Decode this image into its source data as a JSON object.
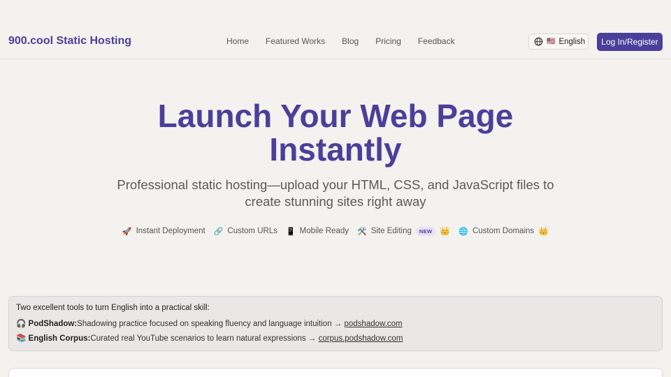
{
  "header": {
    "brand": "900.cool Static Hosting",
    "nav": [
      "Home",
      "Featured Works",
      "Blog",
      "Pricing",
      "Feedback"
    ],
    "language": {
      "flag": "🇺🇸",
      "label": "English",
      "icon": "globe-icon"
    },
    "login_label": "Log In/Register"
  },
  "hero": {
    "title_line1": "Launch Your Web Page",
    "title_line2": "Instantly",
    "subtitle_line1": "Professional static hosting—upload your HTML, CSS, and JavaScript files to",
    "subtitle_line2": "create stunning sites right away"
  },
  "features": [
    {
      "emoji": "🚀",
      "label": "Instant Deployment"
    },
    {
      "emoji": "🔗",
      "label": "Custom URLs"
    },
    {
      "emoji": "📱",
      "label": "Mobile Ready"
    },
    {
      "emoji": "🛠️",
      "label": "Site Editing",
      "badge": "NEW",
      "premium": "👑"
    },
    {
      "emoji": "🌐",
      "label": "Custom Domains",
      "premium": "👑"
    }
  ],
  "promo": {
    "title": "Two excellent tools to turn English into a practical skill:",
    "items": [
      {
        "emoji": "🎧",
        "name": "PodShadow:",
        "desc": "Shadowing practice focused on speaking fluency and language intuition → ",
        "link": "podshadow.com"
      },
      {
        "emoji": "📚",
        "name": "English Corpus:",
        "desc": "Curated real YouTube scenarios to learn natural expressions → ",
        "link": "corpus.podshadow.com"
      }
    ]
  },
  "colors": {
    "accent": "#4b3f9a",
    "background": "#f3f2ef",
    "crown": "#e6a400"
  }
}
